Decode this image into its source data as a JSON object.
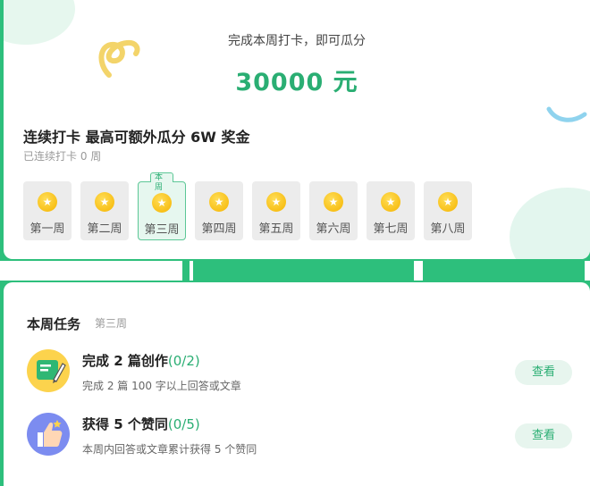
{
  "reward": {
    "subtitle": "完成本周打卡，即可瓜分",
    "amount": "30000 元"
  },
  "streak": {
    "title": "连续打卡 最高可额外瓜分 6W 奖金",
    "status": "已连续打卡 0 周",
    "current_tag": "本周",
    "weeks": [
      "第一周",
      "第二周",
      "第三周",
      "第四周",
      "第五周",
      "第六周",
      "第七周",
      "第八周"
    ],
    "current_index": 2
  },
  "tasks": {
    "title": "本周任务",
    "week_label": "第三周",
    "items": [
      {
        "name": "完成 2 篇创作",
        "progress": "(0/2)",
        "description": "完成 2 篇 100 字以上回答或文章",
        "button": "查看",
        "icon": "document-pencil-icon"
      },
      {
        "name": "获得 5 个赞同",
        "progress": "(0/5)",
        "description": "本周内回答或文章累计获得 5 个赞同",
        "button": "查看",
        "icon": "thumbs-up-icon"
      }
    ]
  },
  "colors": {
    "brand_green": "#2dbf7c",
    "accent_green": "#2aae73",
    "coin_gold": "#f5b400"
  }
}
